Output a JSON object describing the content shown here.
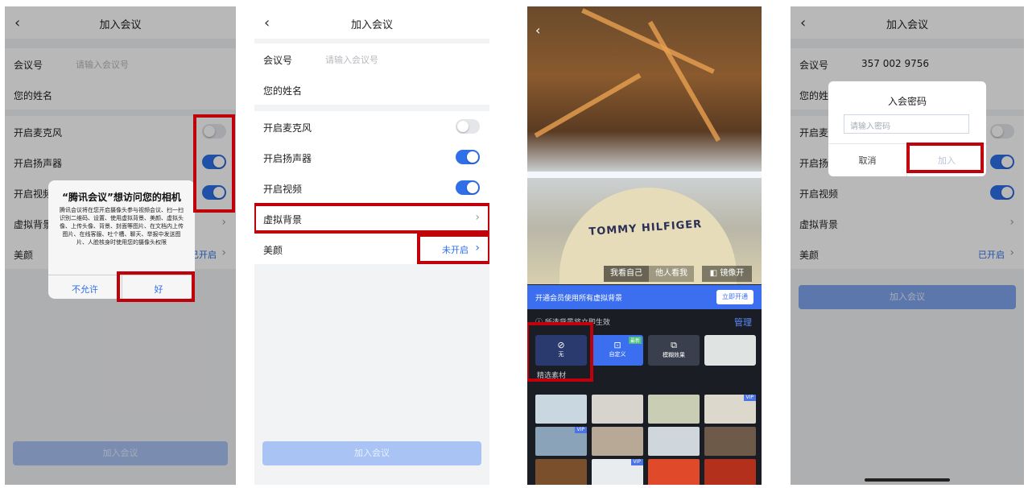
{
  "panel1": {
    "title": "加入会议",
    "meeting_id_label": "会议号",
    "meeting_id_placeholder": "请输入会议号",
    "name_label": "您的姓名",
    "mic_label": "开启麦克风",
    "speaker_label": "开启扬声器",
    "video_label": "开启视频",
    "virtual_bg_label": "虚拟背景",
    "beauty_label": "美颜",
    "beauty_value": "已开启",
    "join_button": "加入会议",
    "mic_on": false,
    "speaker_on": true,
    "video_on": true,
    "dialog": {
      "title": "“腾讯会议”想访问您的相机",
      "body": "腾讯会议将在您开启摄像头参与视频会议、扫一扫识别二维码、设置、使用虚拟背景、美颜、虚拟头像、上传头像、背景、封面等图片、在文档内上传图片、在线客服、吐个槽、聊天、举报中发送图片、人脸核身时使用您的摄像头权限",
      "deny": "不允许",
      "allow": "好"
    }
  },
  "panel2": {
    "title": "加入会议",
    "meeting_id_label": "会议号",
    "meeting_id_placeholder": "请输入会议号",
    "name_label": "您的姓名",
    "mic_label": "开启麦克风",
    "speaker_label": "开启扬声器",
    "video_label": "开启视频",
    "virtual_bg_label": "虚拟背景",
    "beauty_label": "美颜",
    "beauty_value": "未开启",
    "join_button": "加入会议",
    "mic_on": false,
    "speaker_on": true,
    "video_on": true
  },
  "panel3": {
    "cap_text": "TOMMY HILFIGER",
    "tab_self": "我看自己",
    "tab_others": "他人看我",
    "mirror": "镜像开",
    "vip_bar_text": "开通会员使用所有虚拟背景",
    "vip_bar_button": "立即开通",
    "hint": "所选背景将立即生效",
    "manage": "管理",
    "opt_none": "无",
    "opt_custom": "自定义",
    "opt_blur": "模糊效果",
    "new_badge": "最新",
    "section_title": "精选素材",
    "vip_badge": "VIP",
    "colors": {
      "accent": "#3c6ef0"
    }
  },
  "panel4": {
    "title": "加入会议",
    "meeting_id_label": "会议号",
    "meeting_id_value": "357 002 9756",
    "name_label": "您的姓名",
    "mic_label": "开启麦克风",
    "speaker_label": "开启扬声器",
    "video_label": "开启视频",
    "virtual_bg_label": "虚拟背景",
    "beauty_label": "美颜",
    "beauty_value": "已开启",
    "join_button": "加入会议",
    "dialog": {
      "title": "入会密码",
      "placeholder": "请输入密码",
      "cancel": "取消",
      "join": "加入"
    }
  },
  "colors": {
    "highlight": "#c0000b",
    "toggle_on": "#2f6fe8"
  }
}
